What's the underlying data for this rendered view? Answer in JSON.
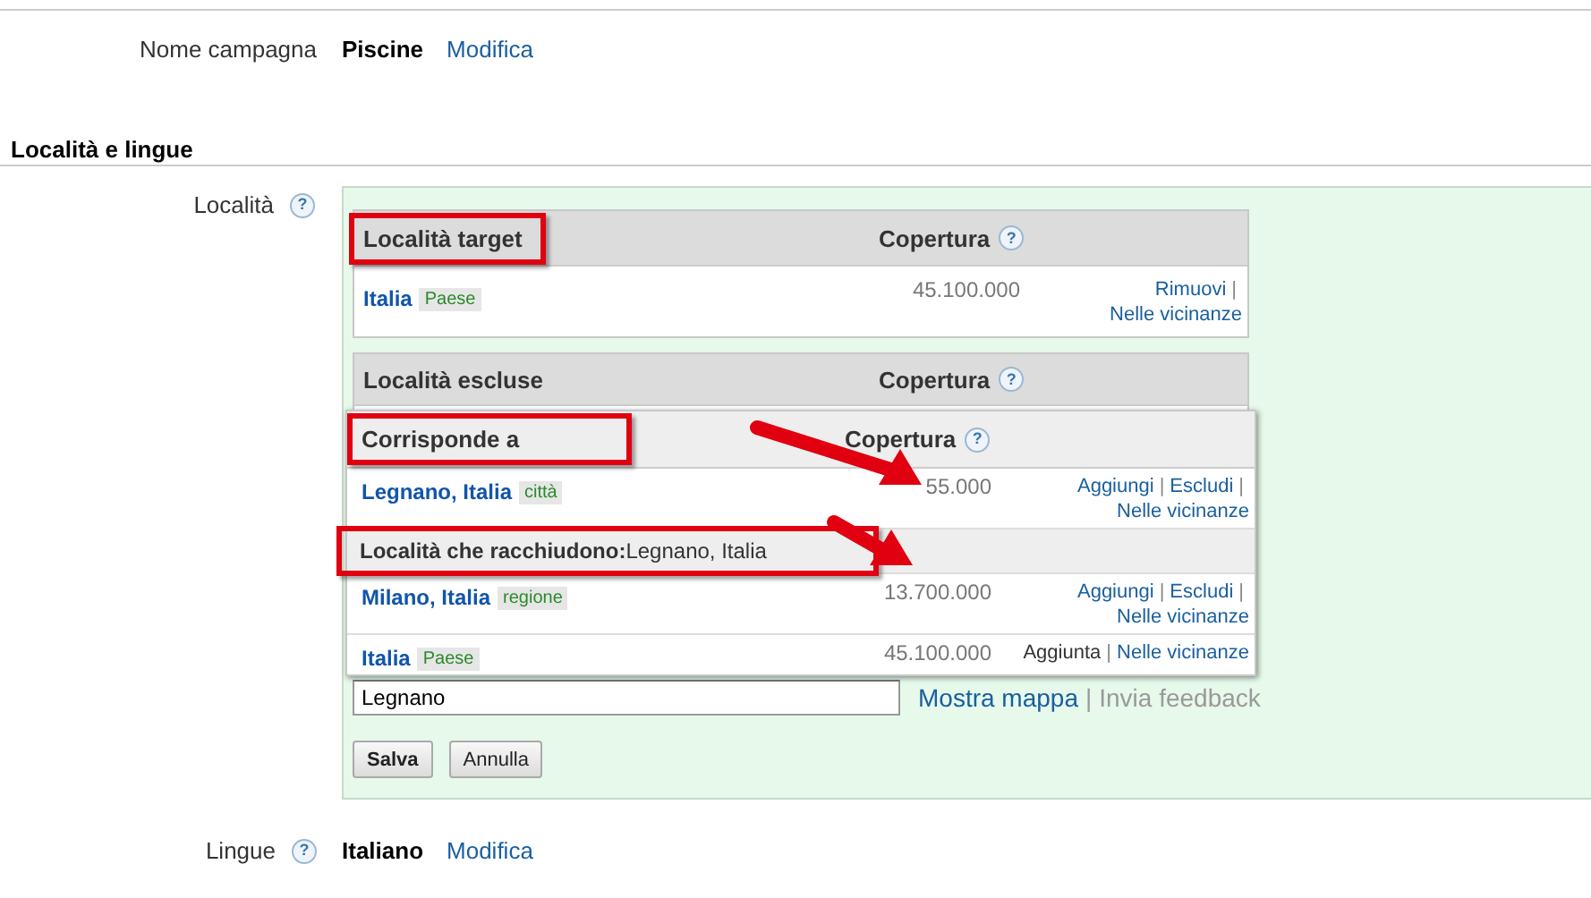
{
  "campaign": {
    "label": "Nome campagna",
    "value": "Piscine",
    "action": "Modifica"
  },
  "section_title": "Località e lingue",
  "locations": {
    "label": "Località",
    "help": "?",
    "target_table": {
      "columns": [
        {
          "label": "Località target",
          "highlighted": true
        },
        {
          "label": "Copertura",
          "help": "?"
        }
      ],
      "rows": [
        {
          "name": "Italia",
          "type": "Paese",
          "coverage": "45.100.000",
          "arrowed": false,
          "action_lines": [
            [
              {
                "label": "Rimuovi",
                "kind": "link"
              },
              {
                "label": "|",
                "kind": "separator"
              }
            ],
            [
              {
                "label": "Nelle vicinanze",
                "kind": "link"
              }
            ]
          ]
        }
      ]
    },
    "excluded_table": {
      "columns": [
        {
          "label": "Località escluse",
          "highlighted": false
        },
        {
          "label": "Copertura",
          "help": "?"
        }
      ]
    },
    "suggestions": {
      "columns": [
        {
          "label": "Corrisponde a",
          "highlighted": true
        },
        {
          "label": "Copertura",
          "help": "?"
        }
      ],
      "groups": [
        {
          "rows": [
            {
              "name": "Legnano, Italia",
              "type": "città",
              "coverage": "55.000",
              "arrowed": true,
              "action_lines": [
                [
                  {
                    "label": "Aggiungi",
                    "kind": "link"
                  },
                  {
                    "label": "|",
                    "kind": "separator"
                  },
                  {
                    "label": "Escludi",
                    "kind": "link"
                  },
                  {
                    "label": "|",
                    "kind": "separator"
                  }
                ],
                [
                  {
                    "label": "Nelle vicinanze",
                    "kind": "link"
                  }
                ]
              ]
            }
          ]
        },
        {
          "title": "**Località che racchiudono:**Legnano, Italia",
          "highlighted": true,
          "arrowed": true,
          "rows": [
            {
              "name": "Milano, Italia",
              "type": "regione",
              "coverage": "13.700.000",
              "arrowed": false,
              "action_lines": [
                [
                  {
                    "label": "Aggiungi",
                    "kind": "link"
                  },
                  {
                    "label": "|",
                    "kind": "separator"
                  },
                  {
                    "label": "Escludi",
                    "kind": "link"
                  },
                  {
                    "label": "|",
                    "kind": "separator"
                  }
                ],
                [
                  {
                    "label": "Nelle vicinanze",
                    "kind": "link"
                  }
                ]
              ]
            },
            {
              "name": "Italia",
              "type": "Paese",
              "coverage": "45.100.000",
              "arrowed": false,
              "action_lines": [
                [
                  {
                    "label": "Aggiunta",
                    "kind": "text"
                  },
                  {
                    "label": "|",
                    "kind": "separator"
                  },
                  {
                    "label": "Nelle vicinanze",
                    "kind": "link"
                  }
                ]
              ]
            }
          ]
        }
      ]
    },
    "search": {
      "value": "Legnano"
    },
    "links": [
      {
        "label": "Mostra mappa",
        "kind": "link"
      },
      {
        "label": "|",
        "kind": "separator"
      },
      {
        "label": "Invia feedback",
        "kind": "muted"
      }
    ],
    "buttons": [
      {
        "label": "Salva",
        "primary": true
      },
      {
        "label": "Annulla",
        "primary": false
      }
    ]
  },
  "languages": {
    "label": "Lingue",
    "help": "?",
    "value": "Italiano",
    "action": "Modifica"
  }
}
